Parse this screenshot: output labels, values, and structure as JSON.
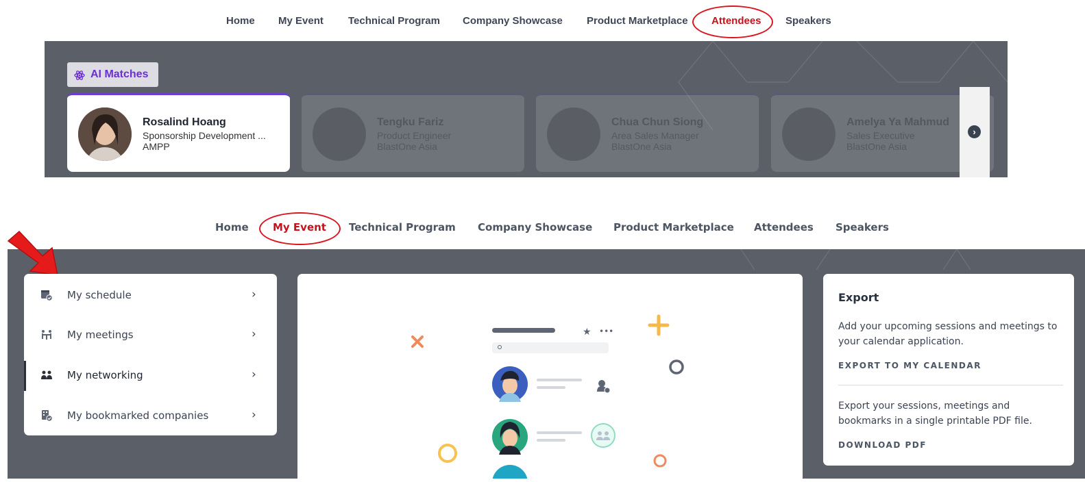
{
  "nav_top": {
    "items": [
      "Home",
      "My Event",
      "Technical Program",
      "Company Showcase",
      "Product Marketplace",
      "Attendees",
      "Speakers"
    ],
    "active": "Attendees"
  },
  "ai_matches": {
    "label": "AI Matches",
    "icon": "atom-icon",
    "cards": [
      {
        "name": "Rosalind Hoang",
        "role": "Sponsorship Development ...",
        "company": "AMPP"
      },
      {
        "name": "Tengku Fariz",
        "role": "Product Engineer",
        "company": "BlastOne Asia"
      },
      {
        "name": "Chua Chun Siong",
        "role": "Area Sales Manager",
        "company": "BlastOne Asia"
      },
      {
        "name": "Amelya Ya Mahmud",
        "role": "Sales Executive",
        "company": "BlastOne Asia"
      }
    ],
    "next_icon": "arrow-right-circle-icon"
  },
  "nav_bottom": {
    "items": [
      "Home",
      "My Event",
      "Technical Program",
      "Company Showcase",
      "Product Marketplace",
      "Attendees",
      "Speakers"
    ],
    "active": "My Event"
  },
  "my_event_menu": {
    "items": [
      {
        "label": "My schedule",
        "icon": "calendar-check-icon"
      },
      {
        "label": "My meetings",
        "icon": "meeting-icon"
      },
      {
        "label": "My networking",
        "icon": "people-icon",
        "selected": true
      },
      {
        "label": "My bookmarked companies",
        "icon": "company-bookmark-icon"
      }
    ],
    "chevron": "›"
  },
  "export_panel": {
    "title": "Export",
    "calendar_text": "Add your upcoming sessions and meetings to your calendar application.",
    "calendar_link": "EXPORT TO MY CALENDAR",
    "pdf_text": "Export your sessions, meetings and bookmarks in a single printable PDF file.",
    "pdf_link": "DOWNLOAD PDF"
  },
  "colors": {
    "active_nav": "#c4131c",
    "highlight_ring": "#d9161f",
    "banner": "#5b5f67",
    "ai_purple": "#6a2ed3"
  }
}
